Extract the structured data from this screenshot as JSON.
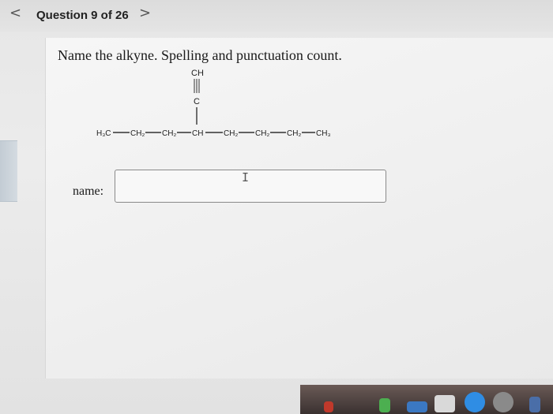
{
  "nav": {
    "prev_icon": "chevron-left-icon",
    "prev_glyph": "<",
    "question_label": "Question 9 of 26",
    "next_icon": "chevron-right-icon",
    "next_glyph": ">"
  },
  "question": {
    "prompt": "Name the alkyne. Spelling and punctuation count.",
    "structure": {
      "branch_top": "CH",
      "branch_mid": "C",
      "chain": [
        "H₃C",
        "CH₂",
        "CH₂",
        "CH",
        "CH₂",
        "CH₂",
        "CH₂",
        "CH₃"
      ]
    }
  },
  "answer": {
    "label": "name:",
    "value": "",
    "placeholder": ""
  }
}
